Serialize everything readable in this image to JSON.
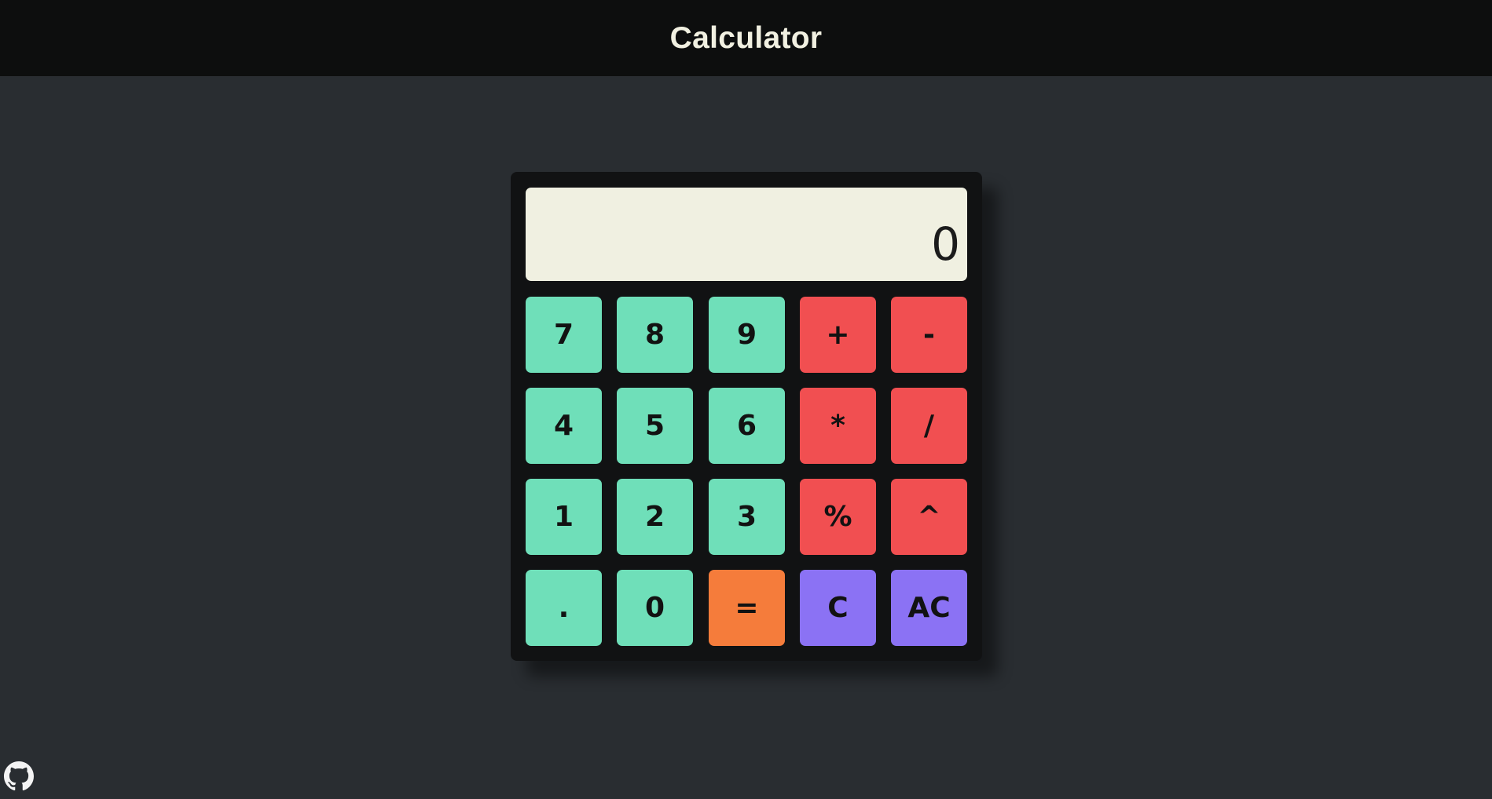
{
  "header": {
    "title": "Calculator"
  },
  "display": {
    "value": "0"
  },
  "keys": {
    "k7": "7",
    "k8": "8",
    "k9": "9",
    "plus": "+",
    "minus": "-",
    "k4": "4",
    "k5": "5",
    "k6": "6",
    "multiply": "*",
    "divide": "/",
    "k1": "1",
    "k2": "2",
    "k3": "3",
    "percent": "%",
    "power": "^",
    "dot": ".",
    "k0": "0",
    "equals": "=",
    "clear": "C",
    "all_clear": "AC"
  },
  "colors": {
    "number_key": "#6fdfb9",
    "operator_key": "#f14f51",
    "equals_key": "#f57c3b",
    "clear_key": "#8b72f4",
    "display_bg": "#f0f0e1",
    "page_bg": "#292d31",
    "header_bg": "#0d0e0e"
  },
  "footer": {
    "icon": "github-icon"
  }
}
